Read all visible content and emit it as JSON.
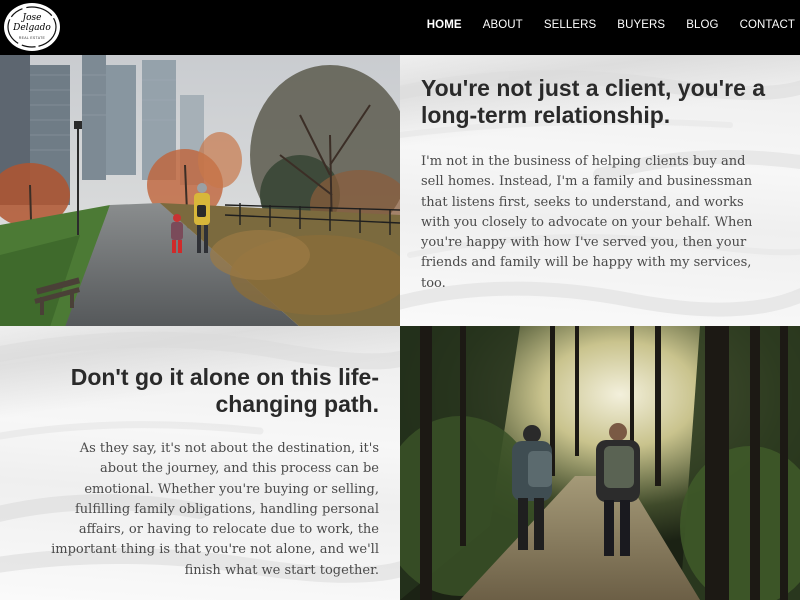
{
  "logo": {
    "name_line1": "Jose",
    "name_line2": "Delgado",
    "tagline": "REAL ESTATE",
    "icon": "brand-logo-icon"
  },
  "nav": {
    "items": [
      {
        "label": "HOME",
        "active": true
      },
      {
        "label": "ABOUT",
        "active": false
      },
      {
        "label": "SELLERS",
        "active": false
      },
      {
        "label": "BUYERS",
        "active": false
      },
      {
        "label": "BLOG",
        "active": false
      },
      {
        "label": "CONTACT",
        "active": false
      }
    ]
  },
  "section_relationship": {
    "heading": "You're not just a client, you're a long-term relationship.",
    "body": "I'm not in the business of helping clients buy and sell homes. Instead, I'm a family and businessman that listens first, seeks to understand, and works with you closely to advocate on your behalf. When you're happy with how I've served you, then your friends and family will be happy with my services, too.",
    "image_icon": "family-walking-park-photo"
  },
  "section_journey": {
    "heading": "Don't go it alone on this life-changing path.",
    "body": "As they say, it's not about the destination, it's about the journey, and this process can be emotional. Whether you're buying or selling, fulfilling family obligations, handling personal affairs, or having to relocate due to work, the important thing is that you're not alone, and we'll finish what we start together.",
    "image_icon": "hikers-forest-trail-photo"
  },
  "colors": {
    "header_bg": "#000000",
    "nav_text": "#ffffff",
    "heading_text": "#2a2a2a",
    "body_text": "#4a4a4a",
    "panel_bg": "#f3f3f3"
  }
}
